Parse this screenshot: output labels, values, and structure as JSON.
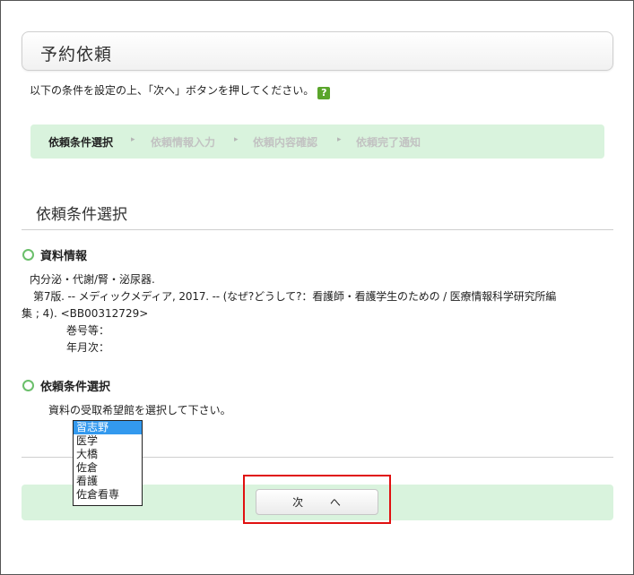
{
  "page": {
    "title": "予約依頼",
    "instruction": "以下の条件を設定の上、「次へ」ボタンを押してください。",
    "help_icon_glyph": "?"
  },
  "steps": {
    "items": [
      "依頼条件選択",
      "依頼情報入力",
      "依頼内容確認",
      "依頼完了通知"
    ],
    "arrow_glyph": "▸"
  },
  "section": {
    "title": "依頼条件選択"
  },
  "material": {
    "heading": "資料情報",
    "title_line": "内分泌・代謝/腎・泌尿器.",
    "detail_line1": "第7版. -- メディックメディア, 2017. -- (なぜ?どうして?：看護師・看護学生のための / 医療情報科学研究所編",
    "detail_line2": "集 ; 4).  <BB00312729>",
    "volume_label": "巻号等：",
    "date_label": "年月次："
  },
  "condition": {
    "heading": "依頼条件選択",
    "prompt": "資料の受取希望館を選択して下さい。",
    "libraries": [
      "習志野",
      "医学",
      "大橋",
      "佐倉",
      "看護",
      "佐倉看専"
    ],
    "selected_library": "習志野"
  },
  "actions": {
    "next_label": "次 へ"
  },
  "colors": {
    "accent_green": "#d9f3dd",
    "bullet_green": "#6bbf6b",
    "highlight_red": "#e01010",
    "selection_blue": "#3399ee"
  }
}
